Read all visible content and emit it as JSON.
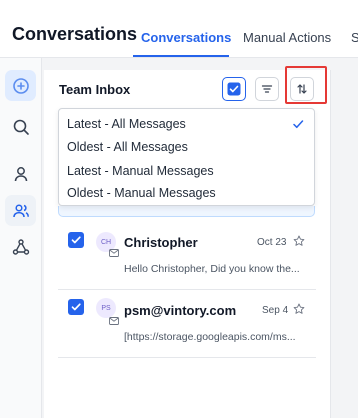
{
  "header": {
    "title": "Conversations",
    "tabs": [
      {
        "label": "Conversations",
        "active": true
      },
      {
        "label": "Manual Actions",
        "active": false
      },
      {
        "label": "S",
        "active": false
      }
    ]
  },
  "sidebar": {
    "items": [
      {
        "icon": "chat-add-icon",
        "active": true
      },
      {
        "icon": "search-icon",
        "active": false
      },
      {
        "icon": "user-icon",
        "active": false
      },
      {
        "icon": "team-icon",
        "active": false
      },
      {
        "icon": "network-icon",
        "active": false
      }
    ]
  },
  "inbox": {
    "title": "Team Inbox",
    "select_all_checked": true,
    "buttons": [
      "select-all-checkbox",
      "filter-icon",
      "sort-icon"
    ]
  },
  "sort_menu": {
    "options": [
      {
        "label": "Latest - All Messages",
        "selected": true
      },
      {
        "label": "Oldest - All Messages",
        "selected": false
      },
      {
        "label": "Latest - Manual Messages",
        "selected": false
      },
      {
        "label": "Oldest - Manual Messages",
        "selected": false
      }
    ]
  },
  "conversations": [
    {
      "initials": "CH",
      "name": "Christopher",
      "date": "Oct 23",
      "preview": "Hello Christopher, Did you know the...",
      "checked": true
    },
    {
      "initials": "PS",
      "name": "psm@vintory.com",
      "date": "Sep 4",
      "preview": "[https://storage.googleapis.com/ms...",
      "checked": true
    }
  ],
  "colors": {
    "accent": "#2563eb",
    "highlight": "#e53935"
  }
}
